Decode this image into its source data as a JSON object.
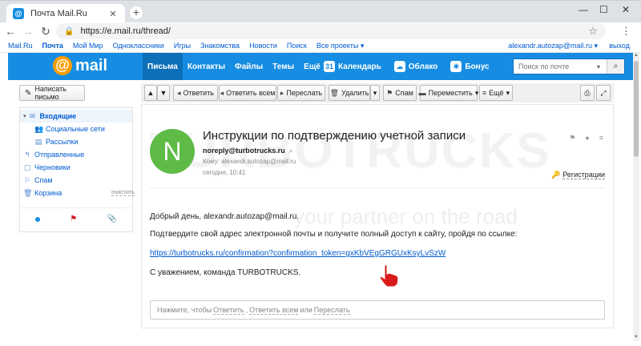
{
  "browser": {
    "tab_title": "Почта Mail.Ru",
    "tab_favicon": "@",
    "new_tab": "+",
    "url": "https://e.mail.ru/thread/",
    "window_controls": [
      "—",
      "☐",
      "✕"
    ]
  },
  "portal": {
    "links": [
      "Mail.Ru",
      "Почта",
      "Мой Мир",
      "Одноклассники",
      "Игры",
      "Знакомства",
      "Новости",
      "Поиск",
      "Все проекты ▾"
    ],
    "user": "alexandr.autozap@mail.ru ▾",
    "exit": "выход"
  },
  "header": {
    "logo_at": "@",
    "logo_text": "mail",
    "nav": [
      "Письма",
      "Контакты",
      "Файлы",
      "Темы",
      "Ещё"
    ],
    "nav2": [
      {
        "label": "Календарь",
        "icon": "31"
      },
      {
        "label": "Облако",
        "icon": "☁"
      },
      {
        "label": "Бонус",
        "icon": "✱"
      }
    ],
    "search_placeholder": "Поиск по почте"
  },
  "sidebar": {
    "compose": "Написать письмо",
    "folders": [
      {
        "label": "Входящие",
        "icon": "✉"
      },
      {
        "label": "Социальные сети",
        "icon": "👥"
      },
      {
        "label": "Рассылки",
        "icon": "▤"
      },
      {
        "label": "Отправленные",
        "icon": "↰"
      },
      {
        "label": "Черновики",
        "icon": "▢"
      },
      {
        "label": "Спам",
        "icon": "⚐"
      },
      {
        "label": "Корзина",
        "icon": "🗑"
      }
    ],
    "clean": "очистить"
  },
  "actions": {
    "reply": "Ответить",
    "reply_all": "Ответить всем",
    "forward": "Переслать",
    "delete": "Удалить",
    "spam": "Спам",
    "move": "Переместить",
    "more": "Ещё"
  },
  "letter": {
    "avatar_letter": "N",
    "subject": "Инструкции по подтверждению учетной записи",
    "from": "noreply@turbotrucks.ru",
    "to": "Кому: alexandr.autozap@mail.ru",
    "time": "сегодня, 10:41",
    "registration": "Регистрации",
    "greeting": "Добрый день, alexandr.autozap@mail.ru.",
    "instruction": "Подтвердите свой адрес электронной почты и получите полный доступ к сайту, пройдя по ссылке:",
    "link": "https://turbotrucks.ru/confirmation?confirmation_token=gxKbVEgGRGUxKsyLvSzW",
    "signature": "С уважением, команда TURBOTRUCKS.",
    "watermark_big": "TURBOTRUCKS",
    "watermark_small": "your partner on the road",
    "reply_prefix": "Нажмите, чтобы",
    "reply_links": [
      "Ответить",
      "Ответить всем",
      "Переслать"
    ],
    "reply_sep1": ",",
    "reply_sep2": "или"
  },
  "colors": {
    "brand_blue": "#168de2",
    "logo_orange": "#ff9e00",
    "avatar_green": "#5dbb46",
    "link_blue": "#005bd1"
  }
}
